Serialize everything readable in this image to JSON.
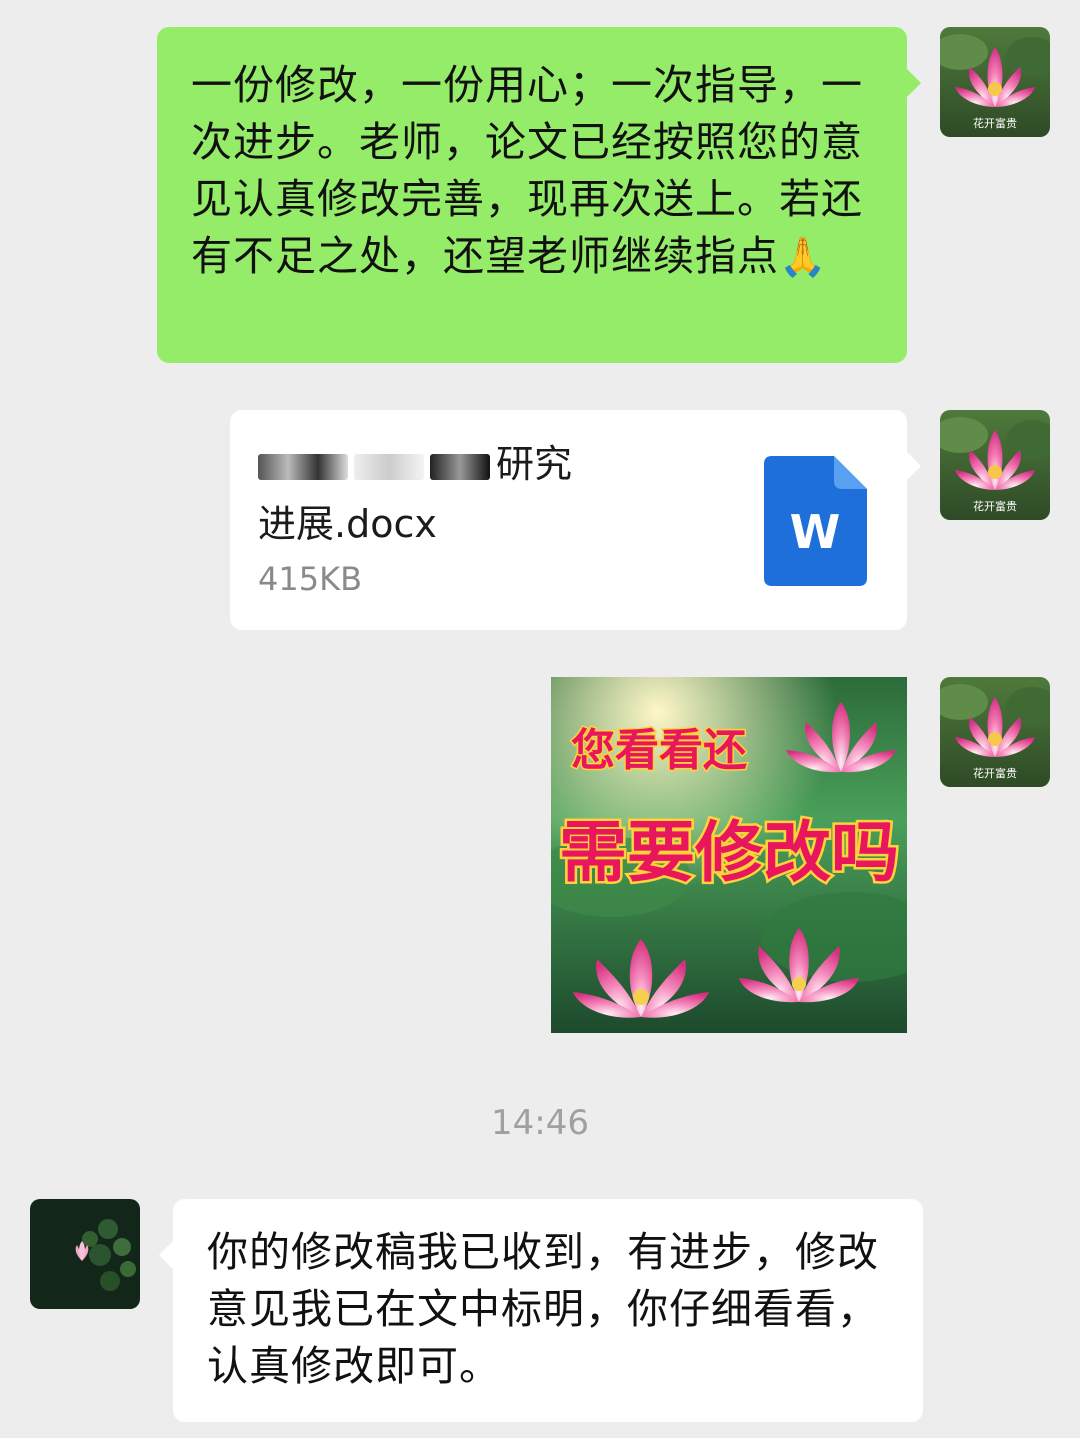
{
  "messages": {
    "sent_text": "一份修改，一份用心；一次指导，一次进步。老师，论文已经按照您的意见认真修改完善，现再次送上。若还有不足之处，还望老师继续指点",
    "sent_emoji": "🙏",
    "file": {
      "name_line1": "研究",
      "name_line2": "进展.docx",
      "size": "415KB",
      "icon_letter": "W",
      "icon": "word-document-icon"
    },
    "sticker": {
      "line1": "您看看还",
      "line2": "需要修改吗"
    },
    "timestamp": "14:46",
    "reply_text": "你的修改稿我已收到，有进步，修改意见我已在文中标明，你仔细看看，认真修改即可。"
  },
  "avatars": {
    "self_caption": "花开富贵"
  },
  "colors": {
    "background": "#ededed",
    "sent_bubble": "#95ec69",
    "received_bubble": "#ffffff",
    "word_blue": "#1e6fd9",
    "sticker_text_red": "#e8175d",
    "sticker_text_gold": "#ffd23a"
  }
}
